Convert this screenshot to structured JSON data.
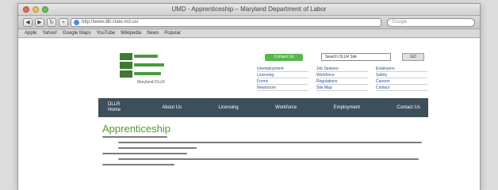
{
  "window": {
    "title": "UMD - Apprenticeship – Maryland Department of Labor",
    "controls": [
      "close",
      "minimize",
      "zoom"
    ]
  },
  "toolbar": {
    "back_icon": "back-arrow-icon",
    "forward_icon": "forward-arrow-icon",
    "reload_icon": "reload-icon",
    "url": "http://www.dllr.state.md.us/",
    "search_placeholder": "Google"
  },
  "bookmarks": {
    "items": [
      "Apple",
      "Yahoo!",
      "Google Maps",
      "YouTube",
      "Wikipedia",
      "News",
      "Popular"
    ]
  },
  "header": {
    "logo_tagline": "Maryland DLLR",
    "donate_label": "Contact Us",
    "search_placeholder": "Search DLLR Site",
    "search_button": "GO",
    "quick_links": [
      "Unemployment",
      "Job Seekers",
      "Employers",
      "Licensing",
      "Workforce",
      "Safety",
      "Forms",
      "Regulations",
      "Careers",
      "Newsroom",
      "Site Map",
      "Contact"
    ]
  },
  "nav": {
    "items": [
      "DLLR Home",
      "About Us",
      "Licensing",
      "Workforce",
      "Employment",
      "Contact Us"
    ]
  },
  "page": {
    "title": "Apprenticeship"
  }
}
